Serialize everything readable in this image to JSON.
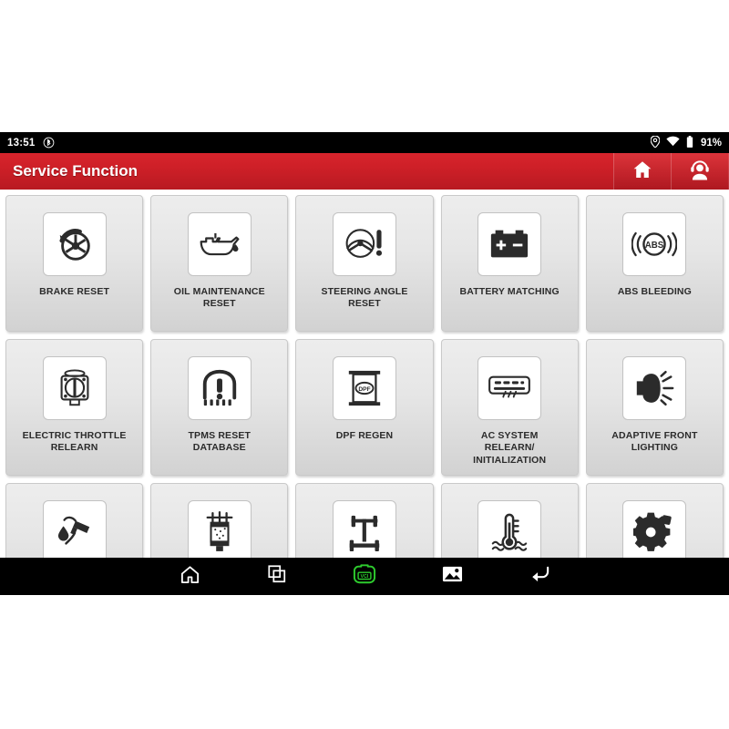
{
  "status_bar": {
    "time": "13:51",
    "bluetooth_icon": "bluetooth-circle-icon",
    "location_icon": "location-pin-icon",
    "wifi_icon": "wifi-icon",
    "battery_icon": "battery-icon",
    "battery_level": "91%"
  },
  "header": {
    "title": "Service Function",
    "home_icon": "home-icon",
    "support_icon": "support-agent-icon"
  },
  "tiles": [
    {
      "label": "BRAKE RESET",
      "icon": "brake-rotor-icon"
    },
    {
      "label": "OIL MAINTENANCE\nRESET",
      "icon": "oil-can-icon"
    },
    {
      "label": "STEERING ANGLE\nRESET",
      "icon": "steering-wheel-warning-icon"
    },
    {
      "label": "BATTERY MATCHING",
      "icon": "car-battery-icon"
    },
    {
      "label": "ABS BLEEDING",
      "icon": "abs-warning-icon"
    },
    {
      "label": "ELECTRIC THROTTLE\nRELEARN",
      "icon": "throttle-body-icon"
    },
    {
      "label": "TPMS RESET\nDATABASE",
      "icon": "tire-pressure-warning-icon"
    },
    {
      "label": "DPF REGEN",
      "icon": "dpf-filter-icon"
    },
    {
      "label": "AC SYSTEM\nRELEARN/\nINITIALIZATION",
      "icon": "ac-unit-icon"
    },
    {
      "label": "ADAPTIVE FRONT\nLIGHTING",
      "icon": "headlight-beam-icon"
    },
    {
      "label": "",
      "icon": "fuel-nozzle-icon"
    },
    {
      "label": "",
      "icon": "fuel-injector-icon"
    },
    {
      "label": "",
      "icon": "chassis-suspension-icon"
    },
    {
      "label": "",
      "icon": "coolant-temperature-icon"
    },
    {
      "label": "",
      "icon": "gear-settings-icon"
    }
  ],
  "nav_bar": {
    "items": [
      {
        "icon": "home-icon",
        "label": ""
      },
      {
        "icon": "recent-apps-icon",
        "label": ""
      },
      {
        "icon": "vci-connector-icon",
        "label": "VCI"
      },
      {
        "icon": "screenshot-gallery-icon",
        "label": ""
      },
      {
        "icon": "back-icon",
        "label": ""
      }
    ],
    "vci_color": "#2ecc2e"
  },
  "colors": {
    "header_red": "#cc1f27",
    "tile_bg": "#e6e6e6",
    "nav_bg": "#000000",
    "vci_green": "#2ecc2e"
  }
}
